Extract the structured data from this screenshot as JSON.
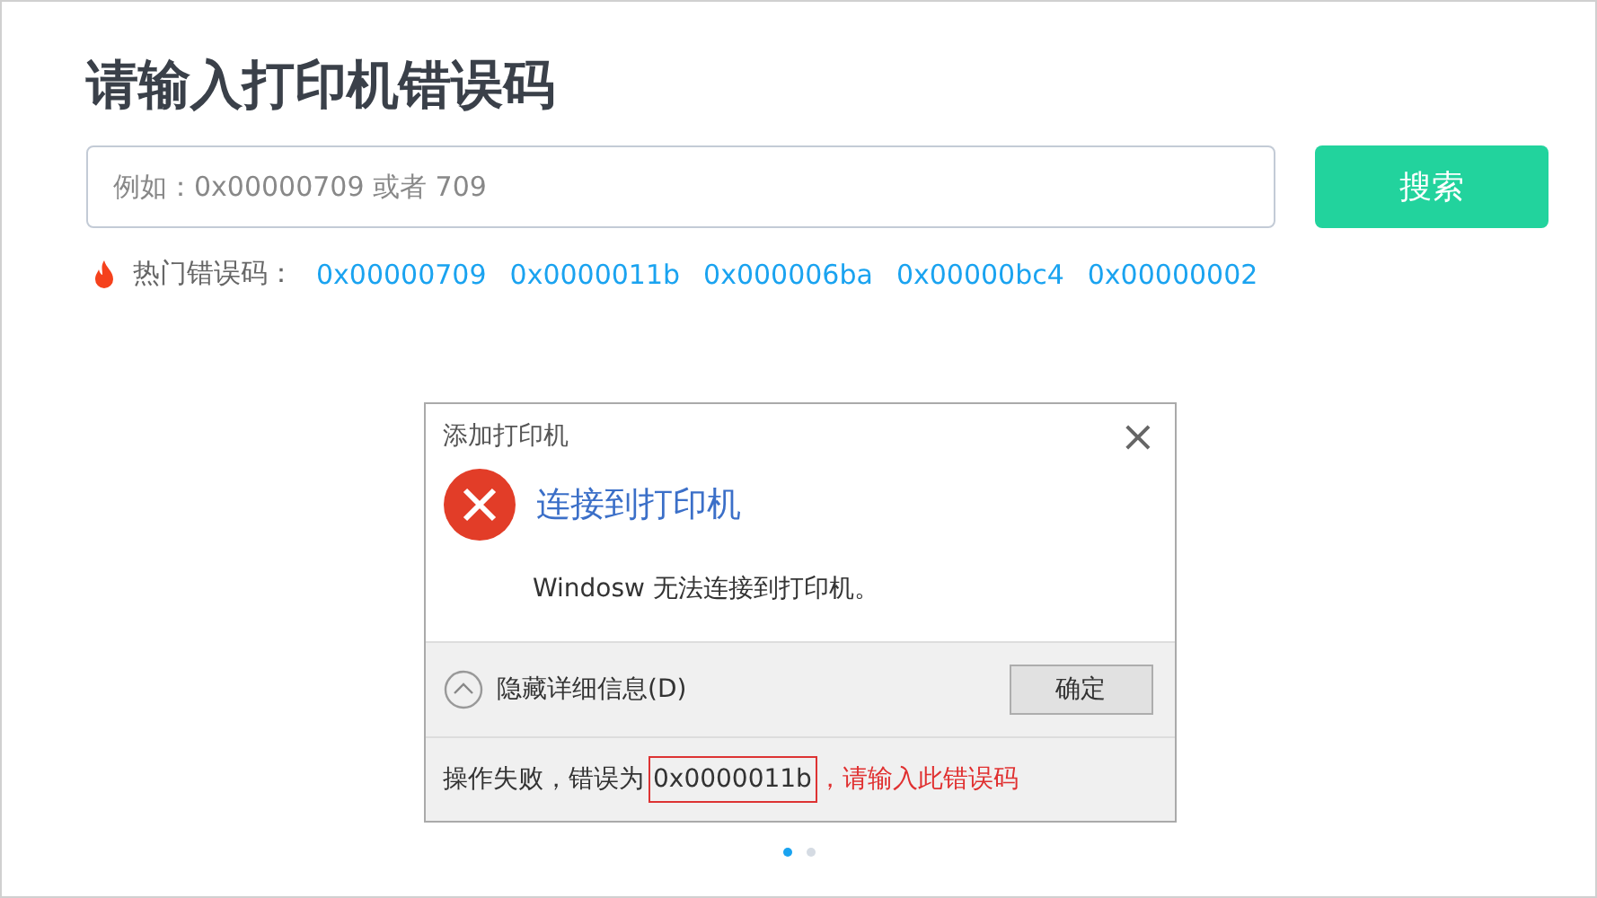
{
  "title": "请输入打印机错误码",
  "search": {
    "placeholder": "例如：0x00000709 或者 709",
    "button": "搜索"
  },
  "hot": {
    "label": "热门错误码：",
    "codes": [
      "0x00000709",
      "0x0000011b",
      "0x000006ba",
      "0x00000bc4",
      "0x00000002"
    ]
  },
  "dialog": {
    "title": "添加打印机",
    "close": "×",
    "heading": "连接到打印机",
    "message": "Windosw 无法连接到打印机。",
    "details": "隐藏详细信息(D)",
    "ok": "确定",
    "footer_prefix": "操作失败，错误为",
    "footer_code": "0x0000011b",
    "footer_hint": "，请输入此错误码"
  },
  "carousel": [
    {
      "selected": true
    },
    {
      "selected": false
    }
  ]
}
